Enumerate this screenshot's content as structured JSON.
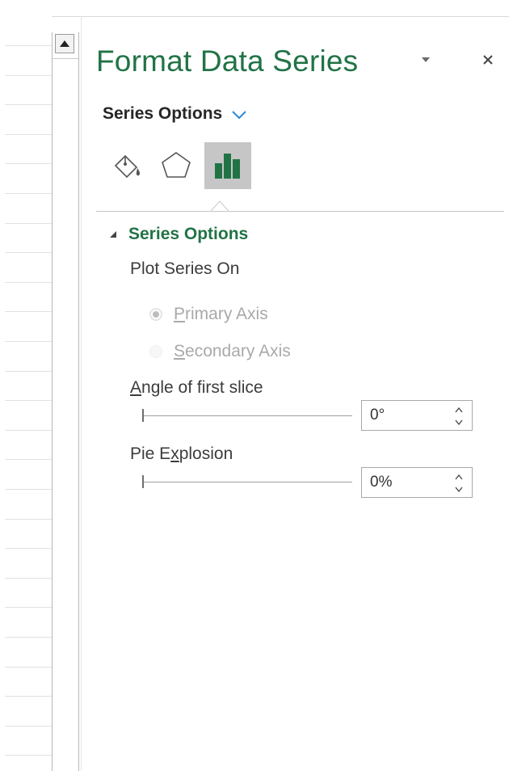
{
  "pane": {
    "title": "Format Data Series",
    "options_menu_label": "Series Options",
    "tabs": [
      {
        "name": "Fill & Line",
        "icon": "paint-bucket-icon",
        "active": false
      },
      {
        "name": "Effects",
        "icon": "pentagon-icon",
        "active": false
      },
      {
        "name": "Series Options",
        "icon": "bar-chart-icon",
        "active": true
      }
    ]
  },
  "section": {
    "title": "Series Options",
    "expanded": true,
    "plot_series_on": {
      "label": "Plot Series On",
      "options": [
        {
          "accel": "P",
          "rest": "rimary Axis",
          "checked": true,
          "enabled": false
        },
        {
          "accel": "S",
          "rest": "econdary Axis",
          "checked": false,
          "enabled": false
        }
      ]
    },
    "angle": {
      "label_accel": "A",
      "label_rest": "ngle of first slice",
      "value": "0°",
      "slider_fraction": 0
    },
    "explosion": {
      "label_pre": "Pie E",
      "label_accel": "x",
      "label_post": "plosion",
      "value": "0%",
      "slider_fraction": 0
    }
  },
  "colors": {
    "accent": "#217346",
    "chevron": "#2b88d8",
    "tab_active_bg": "#c6c6c6"
  }
}
